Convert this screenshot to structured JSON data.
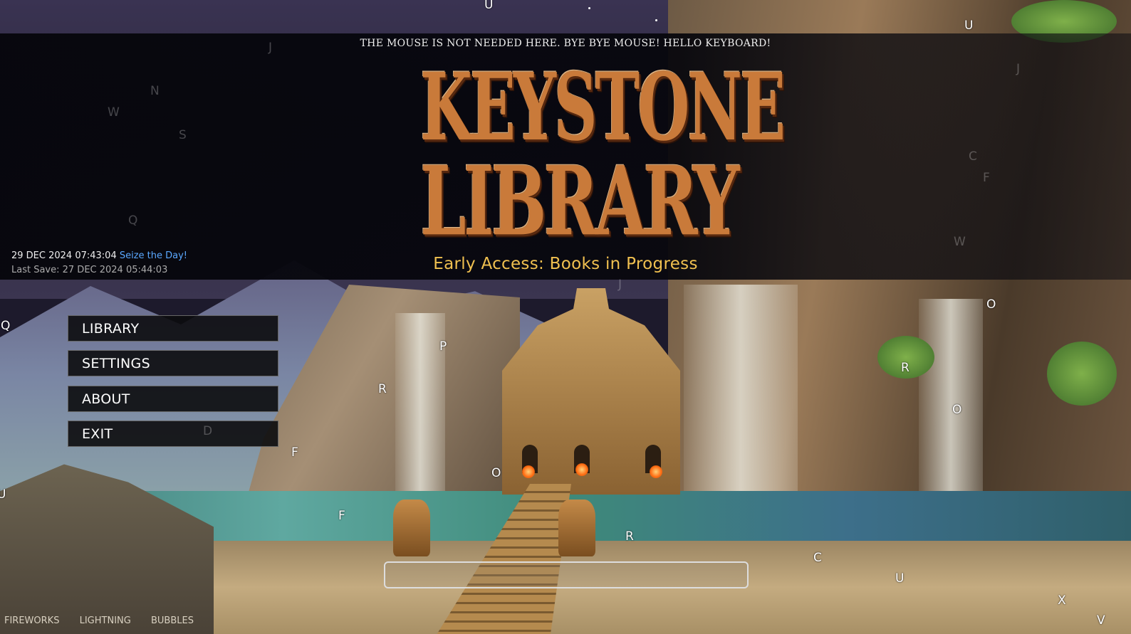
{
  "header": {
    "mouse_tip": "THE MOUSE IS NOT NEEDED HERE. BYE BYE MOUSE! HELLO KEYBOARD!",
    "logo_line1": "KEYSTONE",
    "logo_line2": "LIBRARY",
    "subtitle": "Early Access: Books in Progress"
  },
  "status": {
    "datetime": "29 DEC 2024 07:43:04",
    "motto": "Seize the Day!",
    "last_save": "Last Save: 27 DEC 2024 05:44:03"
  },
  "menu": {
    "items": [
      "LIBRARY",
      "SETTINGS",
      "ABOUT",
      "EXIT"
    ]
  },
  "effects": [
    "FIREWORKS",
    "LIGHTNING",
    "BUBBLES"
  ],
  "floating_letters": [
    "U",
    "U",
    "J",
    "N",
    "W",
    "S",
    "Q",
    "J",
    "C",
    "F",
    "W",
    "J",
    "Q",
    "O",
    "P",
    "R",
    "R",
    "O",
    "D",
    "F",
    "O",
    "U",
    "F",
    "R",
    "C",
    "U",
    "X",
    "V"
  ],
  "colors": {
    "subtitle": "#f0c050",
    "motto": "#5aa8ff",
    "logo": "#c97a3a"
  }
}
